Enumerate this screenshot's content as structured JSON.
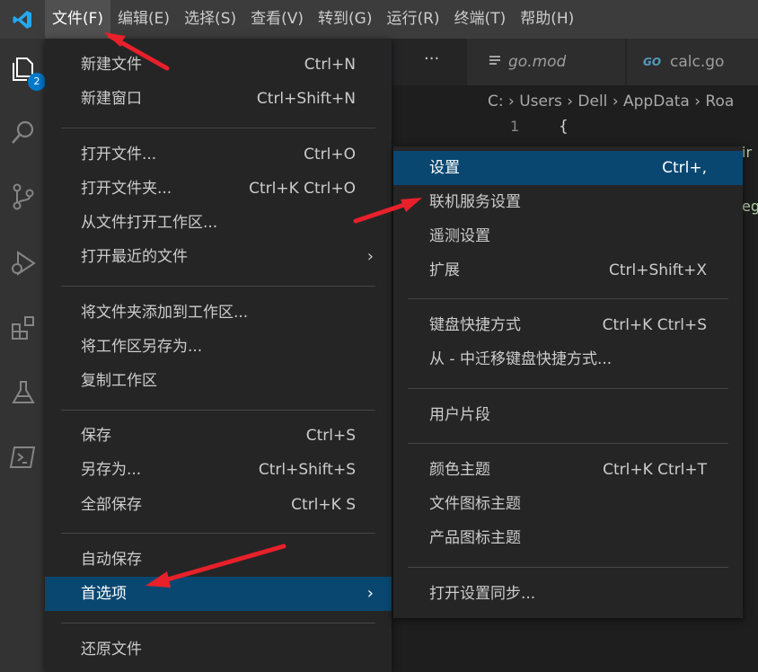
{
  "menubar": {
    "items": [
      "文件(F)",
      "编辑(E)",
      "选择(S)",
      "查看(V)",
      "转到(G)",
      "运行(R)",
      "终端(T)",
      "帮助(H)"
    ]
  },
  "activity": {
    "badge": "2"
  },
  "editor": {
    "overflow": "···",
    "tabs": [
      {
        "label": "go.mod"
      },
      {
        "label": "calc.go",
        "icon_text": "GO"
      }
    ],
    "breadcrumb": "C: › Users › Dell › AppData › Roa",
    "line_number": "1",
    "code": "{",
    "peek_texts": [
      "ir",
      "egr"
    ]
  },
  "file_menu": {
    "items": [
      {
        "label": "新建文件",
        "key": "Ctrl+N"
      },
      {
        "label": "新建窗口",
        "key": "Ctrl+Shift+N"
      },
      {
        "label": "打开文件...",
        "key": "Ctrl+O"
      },
      {
        "label": "打开文件夹...",
        "key": "Ctrl+K Ctrl+O"
      },
      {
        "label": "从文件打开工作区...",
        "key": ""
      },
      {
        "label": "打开最近的文件",
        "key": ""
      },
      {
        "label": "将文件夹添加到工作区...",
        "key": ""
      },
      {
        "label": "将工作区另存为...",
        "key": ""
      },
      {
        "label": "复制工作区",
        "key": ""
      },
      {
        "label": "保存",
        "key": "Ctrl+S"
      },
      {
        "label": "另存为...",
        "key": "Ctrl+Shift+S"
      },
      {
        "label": "全部保存",
        "key": "Ctrl+K S"
      },
      {
        "label": "自动保存",
        "key": ""
      },
      {
        "label": "首选项",
        "key": ""
      },
      {
        "label": "还原文件",
        "key": ""
      }
    ]
  },
  "prefs_menu": {
    "items": [
      {
        "label": "设置",
        "key": "Ctrl+,"
      },
      {
        "label": "联机服务设置",
        "key": ""
      },
      {
        "label": "遥测设置",
        "key": ""
      },
      {
        "label": "扩展",
        "key": "Ctrl+Shift+X"
      },
      {
        "label": "键盘快捷方式",
        "key": "Ctrl+K Ctrl+S"
      },
      {
        "label": "从 - 中迁移键盘快捷方式...",
        "key": ""
      },
      {
        "label": "用户片段",
        "key": ""
      },
      {
        "label": "颜色主题",
        "key": "Ctrl+K Ctrl+T"
      },
      {
        "label": "文件图标主题",
        "key": ""
      },
      {
        "label": "产品图标主题",
        "key": ""
      },
      {
        "label": "打开设置同步...",
        "key": ""
      }
    ]
  },
  "colors": {
    "highlight": "#094771",
    "accent": "#007acc",
    "arrow": "#e8202a"
  }
}
